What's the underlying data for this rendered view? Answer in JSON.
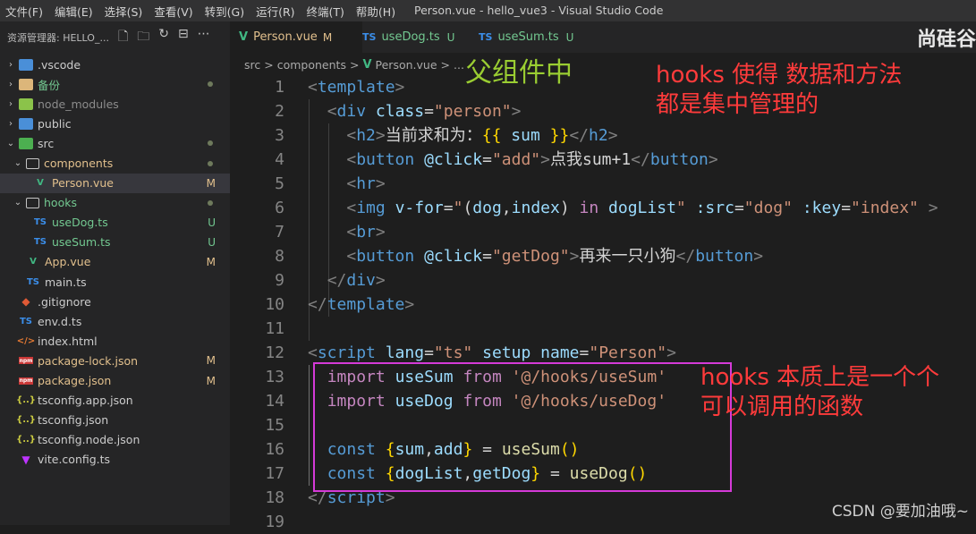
{
  "window": {
    "title": "Person.vue - hello_vue3 - Visual Studio Code"
  },
  "menu": [
    "文件(F)",
    "编辑(E)",
    "选择(S)",
    "查看(V)",
    "转到(G)",
    "运行(R)",
    "终端(T)",
    "帮助(H)"
  ],
  "sidebar": {
    "title": "资源管理器: HELLO_...",
    "items": [
      {
        "label": ".vscode",
        "type": "folder-code",
        "status": ""
      },
      {
        "label": "备份",
        "type": "folder",
        "status": "dot"
      },
      {
        "label": "node_modules",
        "type": "folder-node",
        "status": ""
      },
      {
        "label": "public",
        "type": "folder",
        "status": ""
      },
      {
        "label": "src",
        "type": "folder-src",
        "status": "dot"
      },
      {
        "label": "components",
        "type": "folder",
        "status": "dot"
      },
      {
        "label": "Person.vue",
        "type": "vue",
        "status": "M"
      },
      {
        "label": "hooks",
        "type": "folder",
        "status": "dot"
      },
      {
        "label": "useDog.ts",
        "type": "ts",
        "status": "U"
      },
      {
        "label": "useSum.ts",
        "type": "ts",
        "status": "U"
      },
      {
        "label": "App.vue",
        "type": "vue",
        "status": "M"
      },
      {
        "label": "main.ts",
        "type": "ts",
        "status": ""
      },
      {
        "label": ".gitignore",
        "type": "git",
        "status": ""
      },
      {
        "label": "env.d.ts",
        "type": "ts",
        "status": ""
      },
      {
        "label": "index.html",
        "type": "html",
        "status": ""
      },
      {
        "label": "package-lock.json",
        "type": "npm",
        "status": "M"
      },
      {
        "label": "package.json",
        "type": "npm",
        "status": "M"
      },
      {
        "label": "tsconfig.app.json",
        "type": "json",
        "status": ""
      },
      {
        "label": "tsconfig.json",
        "type": "json",
        "status": ""
      },
      {
        "label": "tsconfig.node.json",
        "type": "json",
        "status": ""
      },
      {
        "label": "vite.config.ts",
        "type": "vite",
        "status": ""
      }
    ]
  },
  "tabs": [
    {
      "label": "Person.vue",
      "badge": "M",
      "icon": "V"
    },
    {
      "label": "useDog.ts",
      "badge": "U",
      "icon": "TS"
    },
    {
      "label": "useSum.ts",
      "badge": "U",
      "icon": "TS"
    }
  ],
  "brand": "尚硅谷",
  "breadcrumb": {
    "p1": "src",
    "sep": ">",
    "p2": "components",
    "p3": "Person.vue",
    "p4": "..."
  },
  "code": {
    "lines": [
      "1",
      "2",
      "3",
      "4",
      "5",
      "6",
      "7",
      "8",
      "9",
      "10",
      "11",
      "12",
      "13",
      "14",
      "15",
      "16",
      "17",
      "18",
      "19"
    ],
    "l1_tag": "template",
    "l2_tag": "div",
    "l2_attr": "class",
    "l2_val": "\"person\"",
    "l3_tag": "h2",
    "l3_text": "当前求和为：",
    "l3_var": "sum",
    "l3_close": "h2",
    "l4_tag": "button",
    "l4_attr": "@click",
    "l4_val": "\"add\"",
    "l4_text": "点我sum+1",
    "l4_close": "button",
    "l5_tag": "hr",
    "l6_tag": "img",
    "l6_attr1": "v-for",
    "l6_val1a": "\"",
    "l6_v1": "(",
    "l6_dog": "dog",
    "l6_comma": ",",
    "l6_index": "index",
    "l6_v2": ")",
    "l6_in": "in",
    "l6_list": "dogList",
    "l6_q": "\"",
    "l6_attr2": ":src",
    "l6_val2": "\"dog\"",
    "l6_attr3": ":key",
    "l6_val3": "\"index\"",
    "l7_tag": "br",
    "l8_tag": "button",
    "l8_attr": "@click",
    "l8_val": "\"getDog\"",
    "l8_text": "再来一只小狗",
    "l8_close": "button",
    "l9_tag": "div",
    "l10_tag": "template",
    "l12_tag": "script",
    "l12_attr1": "lang",
    "l12_val1": "\"ts\"",
    "l12_attr2": "setup",
    "l12_attr3": "name",
    "l12_val3": "\"Person\"",
    "l13_kw": "import",
    "l13_name": "useSum",
    "l13_from": "from",
    "l13_path": "'@/hooks/useSum'",
    "l14_kw": "import",
    "l14_name": "useDog",
    "l14_from": "from",
    "l14_path": "'@/hooks/useDog'",
    "l16_kw": "const",
    "l16_a": "sum",
    "l16_b": "add",
    "l16_fn": "useSum",
    "l17_kw": "const",
    "l17_a": "dogList",
    "l17_b": "getDog",
    "l17_fn": "useDog",
    "l18_tag": "script"
  },
  "annotations": {
    "parent": "父组件中",
    "hooks1_line1": "hooks 使得 数据和方法",
    "hooks1_line2": "都是集中管理的",
    "hooks2_line1": "hooks 本质上是一个个",
    "hooks2_line2": "可以调用的函数",
    "colors": {
      "parent": "#9acd32",
      "red": "#ff3b3b",
      "box": "#d53ad8"
    }
  },
  "watermark": "CSDN @要加油哦~"
}
